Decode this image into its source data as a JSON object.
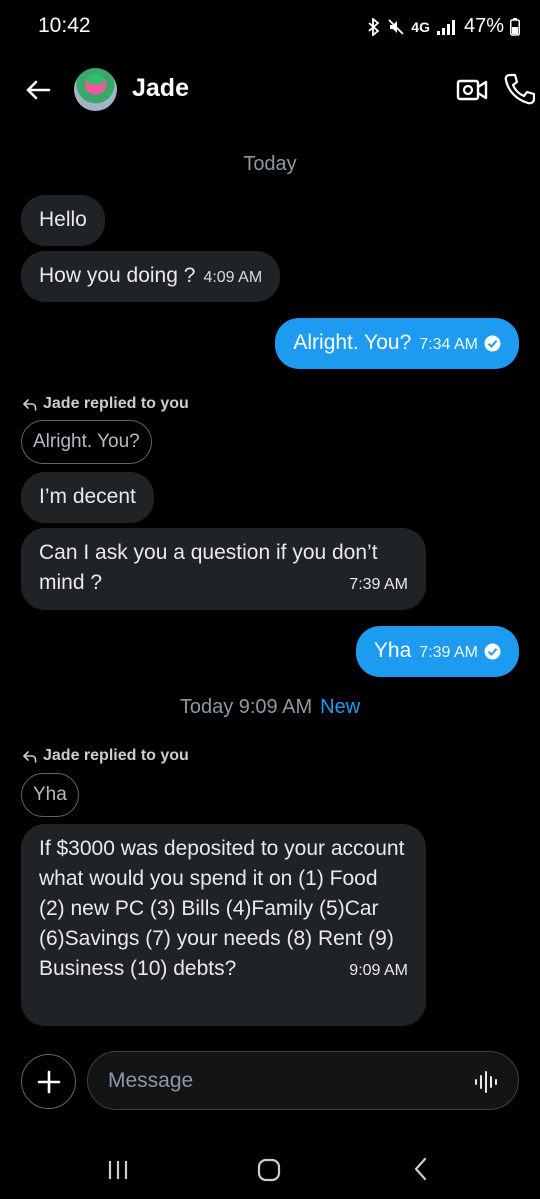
{
  "status": {
    "time": "10:42",
    "network": "4G",
    "battery": "47%"
  },
  "header": {
    "name": "Jade"
  },
  "dates": {
    "first": "Today",
    "second": "Today 9:09 AM",
    "new_label": "New"
  },
  "messages": [
    {
      "text": "Hello",
      "time": ""
    },
    {
      "text": "How you doing ?",
      "time": "4:09 AM"
    },
    {
      "text": "Alright. You?",
      "time": "7:34 AM"
    },
    {
      "text": "I’m decent",
      "time": ""
    },
    {
      "text": "Can I ask you a question if you don’t mind ?",
      "time": "7:39 AM"
    },
    {
      "text": "Yha",
      "time": "7:39 AM"
    },
    {
      "text": "If $3000 was deposited to your account what would you spend it on (1) Food  (2) new PC (3) Bills (4)Family (5)Car (6)Savings (7) your needs (8) Rent (9) Business (10) debts?",
      "time": "9:09 AM"
    }
  ],
  "replies": [
    {
      "label": "Jade replied to you",
      "quoted": "Alright. You?"
    },
    {
      "label": "Jade replied to you",
      "quoted": "Yha"
    }
  ],
  "composer": {
    "placeholder": "Message"
  },
  "colors": {
    "accent": "#1d9bf0",
    "incoming": "#1f2326",
    "background": "#000000"
  }
}
